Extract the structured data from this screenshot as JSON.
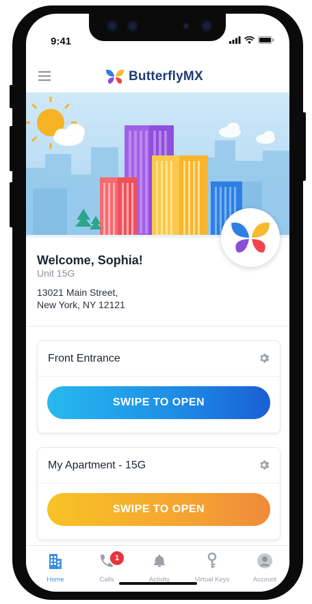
{
  "status_bar": {
    "time": "9:41"
  },
  "header": {
    "brand": "ButterflyMX"
  },
  "welcome": {
    "greeting": "Welcome, Sophia!",
    "unit": "Unit 15G",
    "address_line1": "13021 Main Street,",
    "address_line2": "New York, NY 12121"
  },
  "doors": [
    {
      "name": "Front Entrance",
      "action": "SWIPE TO OPEN",
      "color": "#1e8fe6"
    },
    {
      "name": "My Apartment - 15G",
      "action": "SWIPE TO OPEN",
      "color": "#f5a531"
    }
  ],
  "tabs": [
    {
      "label": "Home",
      "icon": "building-icon",
      "active": true
    },
    {
      "label": "Calls",
      "icon": "phone-icon",
      "badge": "1"
    },
    {
      "label": "Activity",
      "icon": "bell-icon"
    },
    {
      "label": "Virtual Keys",
      "icon": "key-icon"
    },
    {
      "label": "Account",
      "icon": "user-icon"
    }
  ],
  "colors": {
    "accent": "#3a8fde",
    "brand_text": "#1f3b73",
    "badge": "#e8323c"
  }
}
